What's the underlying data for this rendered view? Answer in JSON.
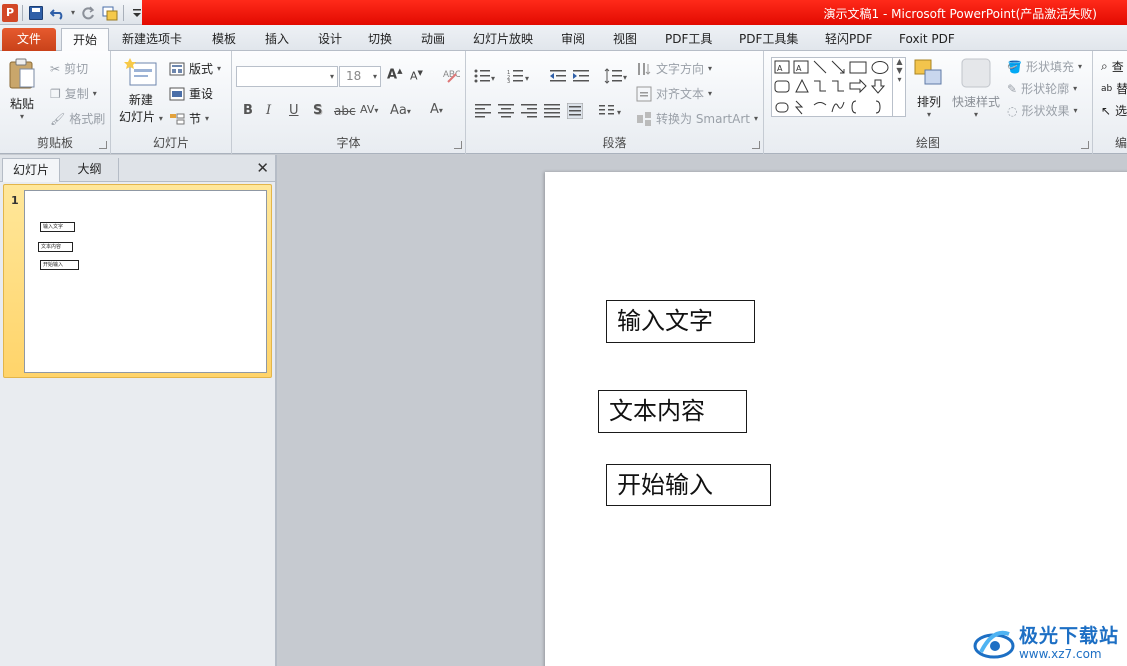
{
  "titlebar": {
    "title": "演示文稿1 - Microsoft PowerPoint(产品激活失败)",
    "app_icon": "powerpoint-logo-icon",
    "qat_icons": [
      "save-icon",
      "undo-icon",
      "redo-icon",
      "new-slide-icon",
      "customize-qat-icon"
    ]
  },
  "tabs": {
    "file": "文件",
    "items": [
      "开始",
      "新建选项卡",
      "模板",
      "插入",
      "设计",
      "切换",
      "动画",
      "幻灯片放映",
      "审阅",
      "视图",
      "PDF工具",
      "PDF工具集",
      "轻闪PDF",
      "Foxit PDF"
    ],
    "active_index": 0
  },
  "ribbon": {
    "clipboard": {
      "label": "剪贴板",
      "paste": "粘贴",
      "cut": "剪切",
      "copy": "复制",
      "format_painter": "格式刷"
    },
    "slides": {
      "label": "幻灯片",
      "new_slide_line1": "新建",
      "new_slide_line2": "幻灯片",
      "layout": "版式",
      "reset": "重设",
      "section": "节"
    },
    "font": {
      "label": "字体",
      "font_name": "",
      "font_size": "18",
      "bold": "B",
      "italic": "I",
      "underline": "U",
      "shadow": "S",
      "strike": "abc",
      "spacing": "AV",
      "case": "Aa",
      "color": "A",
      "grow": "A",
      "shrink": "A"
    },
    "paragraph": {
      "label": "段落",
      "text_direction": "文字方向",
      "align_text": "对齐文本",
      "convert_smartart": "转换为 SmartArt"
    },
    "drawing": {
      "label": "绘图",
      "arrange": "排列",
      "quick_styles": "快速样式",
      "shape_fill": "形状填充",
      "shape_outline": "形状轮廓",
      "shape_effects": "形状效果"
    },
    "editing": {
      "label": "编",
      "find": "查",
      "replace": "替",
      "select": "选"
    }
  },
  "left_panel": {
    "tab_slides": "幻灯片",
    "tab_outline": "大纲",
    "close": "✕",
    "slide_number": "1"
  },
  "slide": {
    "textboxes": [
      "输入文字",
      "文本内容",
      "开始输入"
    ]
  },
  "watermark": {
    "title": "极光下载站",
    "url": "www.xz7.com"
  }
}
